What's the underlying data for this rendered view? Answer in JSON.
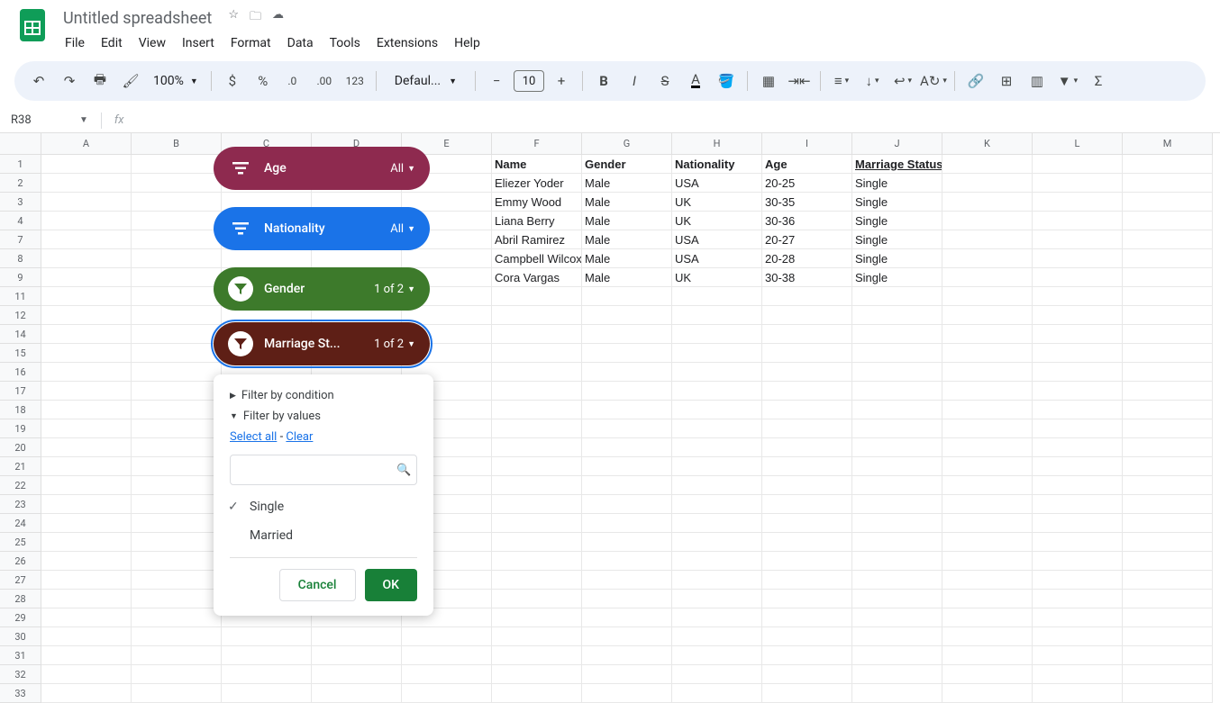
{
  "doc": {
    "title": "Untitled spreadsheet"
  },
  "menu": [
    "File",
    "Edit",
    "View",
    "Insert",
    "Format",
    "Data",
    "Tools",
    "Extensions",
    "Help"
  ],
  "toolbar": {
    "zoom": "100%",
    "font": "Defaul...",
    "size": "10"
  },
  "namebox": "R38",
  "columns": [
    "A",
    "B",
    "C",
    "D",
    "E",
    "F",
    "G",
    "H",
    "I",
    "J",
    "K",
    "L",
    "M"
  ],
  "visible_rows": [
    1,
    2,
    3,
    4,
    7,
    8,
    9,
    11,
    12,
    14,
    15,
    16,
    17,
    18,
    19,
    20,
    21,
    22,
    23,
    24,
    25,
    26,
    27,
    28,
    29,
    30,
    31,
    32,
    33
  ],
  "table": {
    "headers": [
      "Name",
      "Gender",
      "Nationality",
      "Age",
      "Marriage Status"
    ],
    "rows": [
      [
        "Eliezer Yoder",
        "Male",
        "USA",
        "20-25",
        "Single"
      ],
      [
        "Emmy Wood",
        "Male",
        "UK",
        "30-35",
        "Single"
      ],
      [
        "Liana Berry",
        "Male",
        "UK",
        "30-36",
        "Single"
      ],
      [
        "Abril Ramirez",
        "Male",
        "USA",
        "20-27",
        "Single"
      ],
      [
        "Campbell Wilcox",
        "Male",
        "USA",
        "20-28",
        "Single"
      ],
      [
        "Cora Vargas",
        "Male",
        "UK",
        "30-38",
        "Single"
      ]
    ]
  },
  "slicers": [
    {
      "label": "Age",
      "value": "All",
      "class": "age",
      "icon": "bars"
    },
    {
      "label": "Nationality",
      "value": "All",
      "class": "nat",
      "icon": "bars"
    },
    {
      "label": "Gender",
      "value": "1 of 2",
      "class": "gen",
      "icon": "funnel"
    },
    {
      "label": "Marriage St...",
      "value": "1 of 2",
      "class": "mar",
      "icon": "funnel"
    }
  ],
  "filter_popup": {
    "condition_label": "Filter by condition",
    "values_label": "Filter by values",
    "select_all": "Select all",
    "clear": "Clear",
    "options": [
      {
        "label": "Single",
        "checked": true
      },
      {
        "label": "Married",
        "checked": false
      }
    ],
    "cancel": "Cancel",
    "ok": "OK"
  }
}
